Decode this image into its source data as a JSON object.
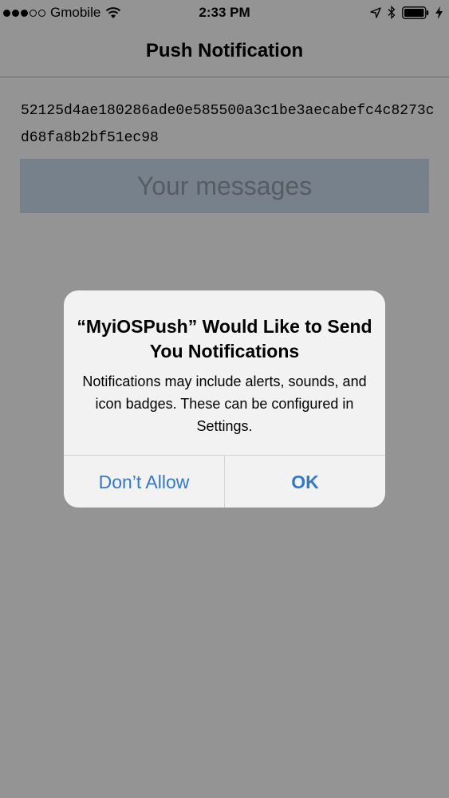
{
  "status_bar": {
    "carrier": "Gmobile",
    "time": "2:33 PM",
    "icons": [
      "signal-dots",
      "wifi-icon",
      "location-arrow-icon",
      "bluetooth-icon",
      "battery-icon",
      "charging-bolt-icon"
    ]
  },
  "nav": {
    "title": "Push Notification"
  },
  "content": {
    "device_token": "52125d4ae180286ade0e585500a3c1be3aecabefc4c8273cd68fa8b2bf51ec98",
    "messages_placeholder": "Your messages"
  },
  "alert": {
    "title": "“MyiOSPush” Would Like to Send You Notifications",
    "message": "Notifications may include alerts, sounds, and icon badges. These can be configured in Settings.",
    "dont_allow_label": "Don’t Allow",
    "ok_label": "OK"
  },
  "colors": {
    "accent": "#3478c6",
    "messages_box": "#c6d7ea"
  }
}
